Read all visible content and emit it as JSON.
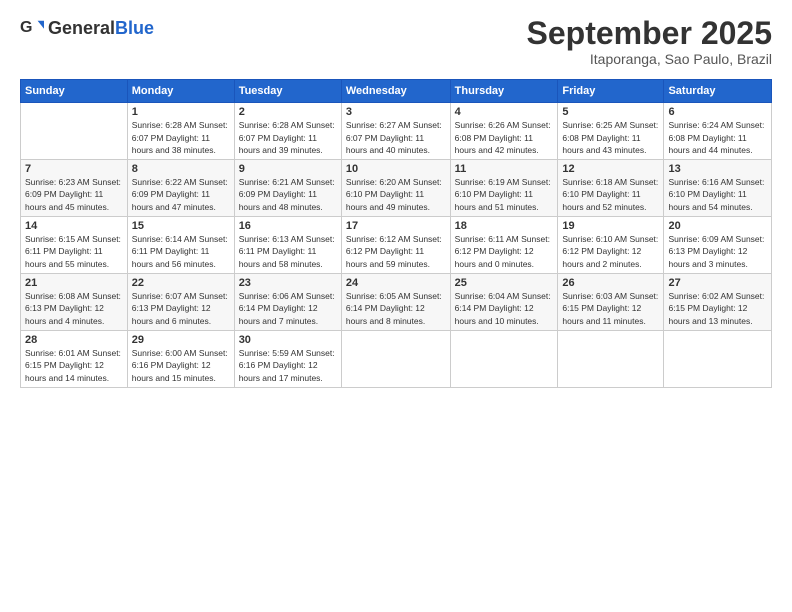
{
  "header": {
    "logo_general": "General",
    "logo_blue": "Blue",
    "month_title": "September 2025",
    "location": "Itaporanga, Sao Paulo, Brazil"
  },
  "weekdays": [
    "Sunday",
    "Monday",
    "Tuesday",
    "Wednesday",
    "Thursday",
    "Friday",
    "Saturday"
  ],
  "weeks": [
    [
      {
        "day": "",
        "info": ""
      },
      {
        "day": "1",
        "info": "Sunrise: 6:28 AM\nSunset: 6:07 PM\nDaylight: 11 hours\nand 38 minutes."
      },
      {
        "day": "2",
        "info": "Sunrise: 6:28 AM\nSunset: 6:07 PM\nDaylight: 11 hours\nand 39 minutes."
      },
      {
        "day": "3",
        "info": "Sunrise: 6:27 AM\nSunset: 6:07 PM\nDaylight: 11 hours\nand 40 minutes."
      },
      {
        "day": "4",
        "info": "Sunrise: 6:26 AM\nSunset: 6:08 PM\nDaylight: 11 hours\nand 42 minutes."
      },
      {
        "day": "5",
        "info": "Sunrise: 6:25 AM\nSunset: 6:08 PM\nDaylight: 11 hours\nand 43 minutes."
      },
      {
        "day": "6",
        "info": "Sunrise: 6:24 AM\nSunset: 6:08 PM\nDaylight: 11 hours\nand 44 minutes."
      }
    ],
    [
      {
        "day": "7",
        "info": "Sunrise: 6:23 AM\nSunset: 6:09 PM\nDaylight: 11 hours\nand 45 minutes."
      },
      {
        "day": "8",
        "info": "Sunrise: 6:22 AM\nSunset: 6:09 PM\nDaylight: 11 hours\nand 47 minutes."
      },
      {
        "day": "9",
        "info": "Sunrise: 6:21 AM\nSunset: 6:09 PM\nDaylight: 11 hours\nand 48 minutes."
      },
      {
        "day": "10",
        "info": "Sunrise: 6:20 AM\nSunset: 6:10 PM\nDaylight: 11 hours\nand 49 minutes."
      },
      {
        "day": "11",
        "info": "Sunrise: 6:19 AM\nSunset: 6:10 PM\nDaylight: 11 hours\nand 51 minutes."
      },
      {
        "day": "12",
        "info": "Sunrise: 6:18 AM\nSunset: 6:10 PM\nDaylight: 11 hours\nand 52 minutes."
      },
      {
        "day": "13",
        "info": "Sunrise: 6:16 AM\nSunset: 6:10 PM\nDaylight: 11 hours\nand 54 minutes."
      }
    ],
    [
      {
        "day": "14",
        "info": "Sunrise: 6:15 AM\nSunset: 6:11 PM\nDaylight: 11 hours\nand 55 minutes."
      },
      {
        "day": "15",
        "info": "Sunrise: 6:14 AM\nSunset: 6:11 PM\nDaylight: 11 hours\nand 56 minutes."
      },
      {
        "day": "16",
        "info": "Sunrise: 6:13 AM\nSunset: 6:11 PM\nDaylight: 11 hours\nand 58 minutes."
      },
      {
        "day": "17",
        "info": "Sunrise: 6:12 AM\nSunset: 6:12 PM\nDaylight: 11 hours\nand 59 minutes."
      },
      {
        "day": "18",
        "info": "Sunrise: 6:11 AM\nSunset: 6:12 PM\nDaylight: 12 hours\nand 0 minutes."
      },
      {
        "day": "19",
        "info": "Sunrise: 6:10 AM\nSunset: 6:12 PM\nDaylight: 12 hours\nand 2 minutes."
      },
      {
        "day": "20",
        "info": "Sunrise: 6:09 AM\nSunset: 6:13 PM\nDaylight: 12 hours\nand 3 minutes."
      }
    ],
    [
      {
        "day": "21",
        "info": "Sunrise: 6:08 AM\nSunset: 6:13 PM\nDaylight: 12 hours\nand 4 minutes."
      },
      {
        "day": "22",
        "info": "Sunrise: 6:07 AM\nSunset: 6:13 PM\nDaylight: 12 hours\nand 6 minutes."
      },
      {
        "day": "23",
        "info": "Sunrise: 6:06 AM\nSunset: 6:14 PM\nDaylight: 12 hours\nand 7 minutes."
      },
      {
        "day": "24",
        "info": "Sunrise: 6:05 AM\nSunset: 6:14 PM\nDaylight: 12 hours\nand 8 minutes."
      },
      {
        "day": "25",
        "info": "Sunrise: 6:04 AM\nSunset: 6:14 PM\nDaylight: 12 hours\nand 10 minutes."
      },
      {
        "day": "26",
        "info": "Sunrise: 6:03 AM\nSunset: 6:15 PM\nDaylight: 12 hours\nand 11 minutes."
      },
      {
        "day": "27",
        "info": "Sunrise: 6:02 AM\nSunset: 6:15 PM\nDaylight: 12 hours\nand 13 minutes."
      }
    ],
    [
      {
        "day": "28",
        "info": "Sunrise: 6:01 AM\nSunset: 6:15 PM\nDaylight: 12 hours\nand 14 minutes."
      },
      {
        "day": "29",
        "info": "Sunrise: 6:00 AM\nSunset: 6:16 PM\nDaylight: 12 hours\nand 15 minutes."
      },
      {
        "day": "30",
        "info": "Sunrise: 5:59 AM\nSunset: 6:16 PM\nDaylight: 12 hours\nand 17 minutes."
      },
      {
        "day": "",
        "info": ""
      },
      {
        "day": "",
        "info": ""
      },
      {
        "day": "",
        "info": ""
      },
      {
        "day": "",
        "info": ""
      }
    ]
  ]
}
